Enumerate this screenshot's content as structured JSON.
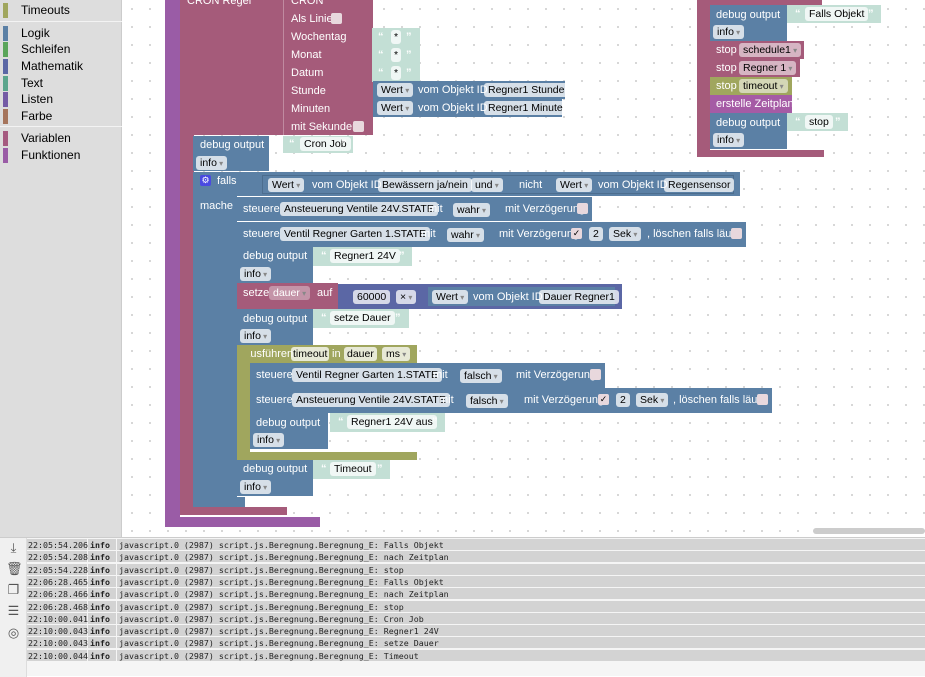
{
  "sidebar": {
    "items": [
      {
        "label": "Timeouts",
        "color": "#a0a65e"
      },
      {
        "label": "Logik",
        "color": "#5b80a5"
      },
      {
        "label": "Schleifen",
        "color": "#5ba55b"
      },
      {
        "label": "Mathematik",
        "color": "#5b67a5"
      },
      {
        "label": "Text",
        "color": "#5ba58c"
      },
      {
        "label": "Listen",
        "color": "#745ba5"
      },
      {
        "label": "Farbe",
        "color": "#a5745b"
      },
      {
        "label": "Variablen",
        "color": "#a55b80"
      },
      {
        "label": "Funktionen",
        "color": "#9a5ca6"
      }
    ]
  },
  "cron": {
    "title": "CRON Regel",
    "cron": "CRON",
    "als_linie": "Als Linie",
    "wochentag": "Wochentag",
    "monat": "Monat",
    "datum": "Datum",
    "stunde": "Stunde",
    "minuten": "Minuten",
    "mit_sekunden": "mit Sekunden",
    "star": "*",
    "wert": "Wert",
    "vom_objekt": "vom Objekt ID",
    "stunde_id": "Regner1 Stunde",
    "minute_id": "Regner1 Minute"
  },
  "common": {
    "debug_output": "debug output",
    "info": "info",
    "steuere": "steuere",
    "mit": "mit",
    "mit_verzoegerung": "mit Verzögerung",
    "loeschen": ", löschen falls läuft",
    "sek": "Sek",
    "zwei": "2",
    "wert": "Wert",
    "vom_objekt": "vom Objekt ID",
    "check": "✓",
    "open_quote": "“",
    "close_quote": "”"
  },
  "main": {
    "debug_cron": "Cron Job",
    "falls": "falls",
    "mache": "mache",
    "cond_id1": "Bewässern ja/nein",
    "und": "und",
    "nicht": "nicht",
    "cond_id2": "Regensensor",
    "s1_id": "Ansteuerung Ventile 24V.STATE",
    "s1_val": "wahr",
    "s2_id": "Ventil Regner Garten 1.STATE",
    "s2_val": "wahr",
    "debug_regner": "Regner1 24V",
    "setze": "setze",
    "var": "dauer",
    "auf": "auf",
    "num": "60000",
    "op": "×",
    "dauer_id": "Dauer Regner1",
    "debug_dauer": "setze Dauer",
    "ausfuehren": "Ausführen",
    "timeout": "timeout",
    "in": "in",
    "dauer": "dauer",
    "ms": "ms",
    "t1_id": "Ventil Regner Garten 1.STATE",
    "t1_val": "falsch",
    "t2_id": "Ansteuerung Ventile 24V.STATE",
    "t2_val": "falsch",
    "debug_aus": "Regner1 24V aus",
    "debug_timeout": "Timeout"
  },
  "right": {
    "debug_falls": "Falls Objekt",
    "stop": "stop",
    "schedule": "schedule1",
    "regner": "Regner 1",
    "timeout": "timeout",
    "erstelle": "erstelle Zeitplan",
    "debug_stop": "stop"
  },
  "log": {
    "rows": [
      [
        "22:05:54.206",
        "info",
        "javascript.0 (2987) script.js.Beregnung.Beregnung_E: Falls Objekt"
      ],
      [
        "22:05:54.208",
        "info",
        "javascript.0 (2987) script.js.Beregnung.Beregnung_E: nach Zeitplan"
      ],
      [
        "22:05:54.228",
        "info",
        "javascript.0 (2987) script.js.Beregnung.Beregnung_E: stop"
      ],
      [
        "22:06:28.465",
        "info",
        "javascript.0 (2987) script.js.Beregnung.Beregnung_E: Falls Objekt"
      ],
      [
        "22:06:28.466",
        "info",
        "javascript.0 (2987) script.js.Beregnung.Beregnung_E: nach Zeitplan"
      ],
      [
        "22:06:28.468",
        "info",
        "javascript.0 (2987) script.js.Beregnung.Beregnung_E: stop"
      ],
      [
        "22:10:00.041",
        "info",
        "javascript.0 (2987) script.js.Beregnung.Beregnung_E: Cron Job"
      ],
      [
        "22:10:00.043",
        "info",
        "javascript.0 (2987) script.js.Beregnung.Beregnung_E: Regner1 24V"
      ],
      [
        "22:10:00.043",
        "info",
        "javascript.0 (2987) script.js.Beregnung.Beregnung_E: setze Dauer"
      ],
      [
        "22:10:00.044",
        "info",
        "javascript.0 (2987) script.js.Beregnung.Beregnung_E: Timeout"
      ]
    ]
  }
}
